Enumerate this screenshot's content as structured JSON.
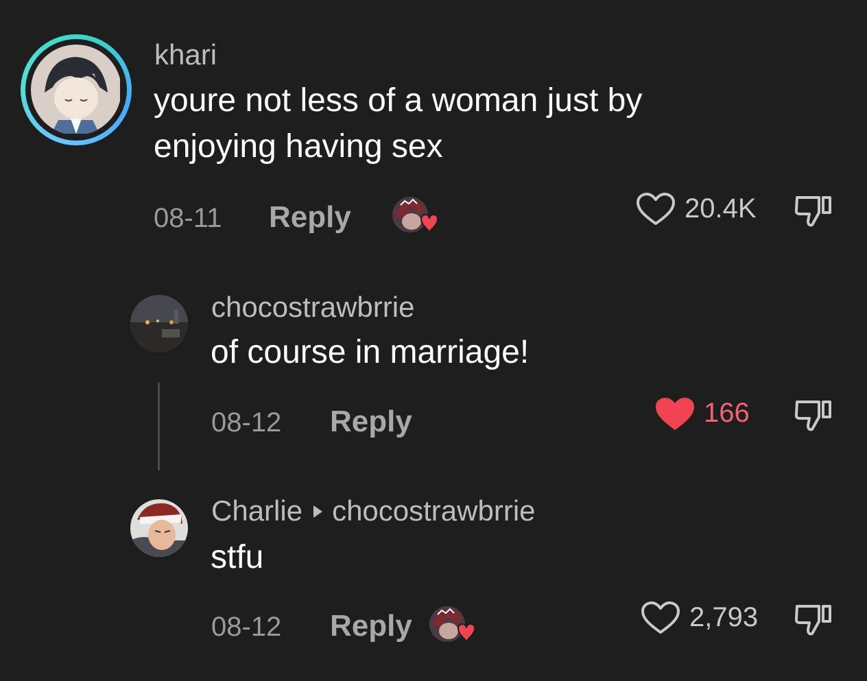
{
  "comments": [
    {
      "username": "khari",
      "text_line1": "youre not less of a woman just by",
      "text_line2": "enjoying having sex",
      "date": "08-11",
      "reply_label": "Reply",
      "likes": "20.4K",
      "liked": false
    },
    {
      "username": "chocostrawbrrie",
      "text": "of course in marriage!",
      "date": "08-12",
      "reply_label": "Reply",
      "likes": "166",
      "liked": true
    },
    {
      "username": "Charlie",
      "reply_to": "chocostrawbrrie",
      "text": "stfu",
      "date": "08-12",
      "reply_label": "Reply",
      "likes": "2,793",
      "liked": false
    }
  ],
  "colors": {
    "background": "#1e1e1f",
    "liked_heart": "#f04452",
    "liked_count": "#f06474",
    "avatar_ring": "#4fe0d0"
  },
  "icons": [
    "heart-outline-icon",
    "heart-filled-icon",
    "dislike-icon",
    "creator-liked-badge-icon",
    "reply-arrow-icon"
  ]
}
